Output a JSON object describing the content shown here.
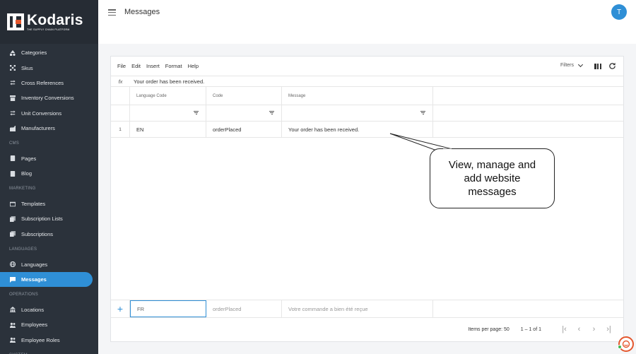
{
  "brand": {
    "name": "Kodaris",
    "tagline": "THE SUPPLY CHAIN PLATFORM"
  },
  "header": {
    "title": "Messages",
    "avatar_initial": "T"
  },
  "sidebar": {
    "items": [
      {
        "label": "Categories",
        "icon": "categories-icon"
      },
      {
        "label": "Skus",
        "icon": "skus-icon"
      },
      {
        "label": "Cross References",
        "icon": "cross-references-icon"
      },
      {
        "label": "Inventory Conversions",
        "icon": "inventory-conversions-icon"
      },
      {
        "label": "Unit Conversions",
        "icon": "unit-conversions-icon"
      },
      {
        "label": "Manufacturers",
        "icon": "manufacturers-icon"
      }
    ],
    "cms_label": "CMS",
    "cms": [
      {
        "label": "Pages",
        "icon": "pages-icon"
      },
      {
        "label": "Blog",
        "icon": "blog-icon"
      }
    ],
    "marketing_label": "MARKETING",
    "marketing": [
      {
        "label": "Templates",
        "icon": "templates-icon"
      },
      {
        "label": "Subscription Lists",
        "icon": "subscription-lists-icon"
      },
      {
        "label": "Subscriptions",
        "icon": "subscriptions-icon"
      }
    ],
    "languages_label": "LANGUAGES",
    "languages": [
      {
        "label": "Languages",
        "icon": "globe-icon"
      },
      {
        "label": "Messages",
        "icon": "chat-icon",
        "active": true
      }
    ],
    "operations_label": "OPERATIONS",
    "operations": [
      {
        "label": "Locations",
        "icon": "locations-icon"
      },
      {
        "label": "Employees",
        "icon": "employees-icon"
      },
      {
        "label": "Employee Roles",
        "icon": "employee-roles-icon"
      }
    ],
    "system_label": "SYSTEM"
  },
  "toolbar": {
    "menus": [
      "File",
      "Edit",
      "Insert",
      "Format",
      "Help"
    ],
    "filters_label": "Filters"
  },
  "formula_bar": {
    "fx": "fx",
    "value": "Your order has been received."
  },
  "grid": {
    "columns": [
      "Language Code",
      "Code",
      "Message"
    ],
    "rows": [
      {
        "num": "1",
        "language_code": "EN",
        "code": "orderPlaced",
        "message": "Your order has been received."
      }
    ],
    "new_row": {
      "language_code": "FR",
      "code_placeholder": "orderPlaced",
      "message_placeholder": "Votre commande a bien été reçue"
    }
  },
  "pagination": {
    "items_per_page_label": "Items per page:",
    "items_per_page": "50",
    "range": "1 – 1 of 1"
  },
  "callout": {
    "text": "View, manage and add website messages"
  },
  "colors": {
    "sidebar_bg": "#2b323b",
    "accent": "#2f8fd6",
    "brand_orange": "#e4572e"
  }
}
